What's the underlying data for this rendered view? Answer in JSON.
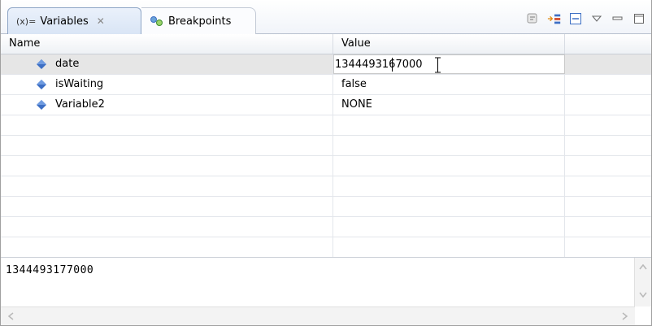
{
  "tabs": [
    {
      "icon": "variables-icon",
      "prefix": "(x)=",
      "label": "Variables",
      "active": true
    },
    {
      "icon": "breakpoints-icon",
      "label": "Breakpoints",
      "active": false
    }
  ],
  "table": {
    "columns": [
      "Name",
      "Value"
    ],
    "rows": [
      {
        "name": "date",
        "value": "1344493167000",
        "selected": true
      },
      {
        "name": "isWaiting",
        "value": "false"
      },
      {
        "name": "Variable2",
        "value": "NONE"
      }
    ]
  },
  "detail": {
    "text": "1344493177000"
  },
  "colors": {
    "variable_icon": "#3d6fc4",
    "selection": "#e6e6e6"
  }
}
